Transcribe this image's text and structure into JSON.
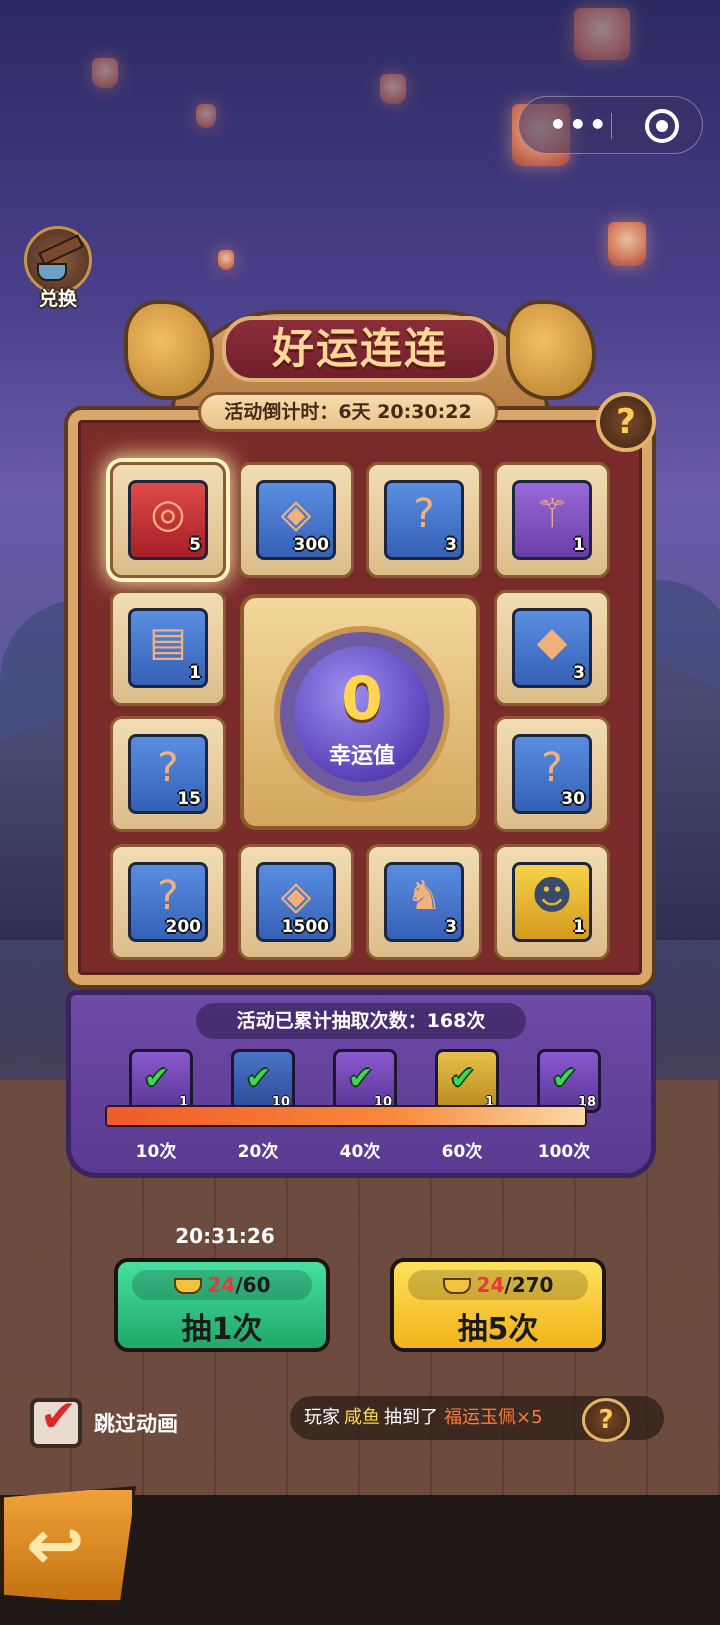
{
  "capsule": {
    "more_icon": "more-dots-icon",
    "close_icon": "target-close-icon"
  },
  "exchange": {
    "label": "兑换"
  },
  "title": "好运连连",
  "countdown": "活动倒计时：6天 20:30:22",
  "help": "?",
  "grid": [
    {
      "qty": "5",
      "color": "red",
      "icon": "jade-pendant-icon",
      "glyph": "◎"
    },
    {
      "qty": "300",
      "color": "blue",
      "icon": "bronze-coin-icon",
      "glyph": "◈"
    },
    {
      "qty": "3",
      "color": "blue",
      "icon": "mystery-scroll-icon",
      "glyph": "?"
    },
    {
      "qty": "1",
      "color": "purple",
      "icon": "trident-icon",
      "glyph": "⚚"
    },
    {
      "qty": "1",
      "color": "blue",
      "icon": "map-scroll-icon",
      "glyph": "▤"
    },
    {
      "qty": "3",
      "color": "blue",
      "icon": "stone-block-icon",
      "glyph": "◆"
    },
    {
      "qty": "15",
      "color": "blue",
      "icon": "mystery-scroll-icon",
      "glyph": "?"
    },
    {
      "qty": "30",
      "color": "blue",
      "icon": "red-mystery-scroll-icon",
      "glyph": "?"
    },
    {
      "qty": "200",
      "color": "blue",
      "icon": "red-mystery-scroll-icon",
      "glyph": "?"
    },
    {
      "qty": "1500",
      "color": "blue",
      "icon": "bronze-coin-icon",
      "glyph": "◈"
    },
    {
      "qty": "3",
      "color": "blue",
      "icon": "beast-statue-icon",
      "glyph": "♞"
    },
    {
      "qty": "1",
      "color": "gold",
      "icon": "hero-portrait-icon",
      "glyph": "☻"
    }
  ],
  "luck": {
    "value": "0",
    "label": "幸运值"
  },
  "milestones": {
    "title": "活动已累计抽取次数：168次",
    "progress": 1.0,
    "items": [
      {
        "qty": "1",
        "color": "purple",
        "icon": "hero-portrait-icon"
      },
      {
        "qty": "10",
        "color": "blue",
        "icon": "ore-icon"
      },
      {
        "qty": "10",
        "color": "purple",
        "icon": "bronze-coin-icon"
      },
      {
        "qty": "1",
        "color": "gold",
        "icon": "hero-portrait-icon"
      },
      {
        "qty": "18",
        "color": "purple",
        "icon": "bronze-coin-icon"
      }
    ],
    "ticks": [
      "10次",
      "20次",
      "40次",
      "60次",
      "100次"
    ]
  },
  "timer": "20:31:26",
  "draw1": {
    "have": "24",
    "need": "/60",
    "label": "抽1次"
  },
  "draw5": {
    "have": "24",
    "need": "/270",
    "label": "抽5次"
  },
  "skip": {
    "label": "跳过动画",
    "checked": true
  },
  "broadcast": {
    "prefix": "玩家",
    "player": "咸鱼",
    "mid": "抽到了",
    "item": "福运玉佩×5"
  }
}
